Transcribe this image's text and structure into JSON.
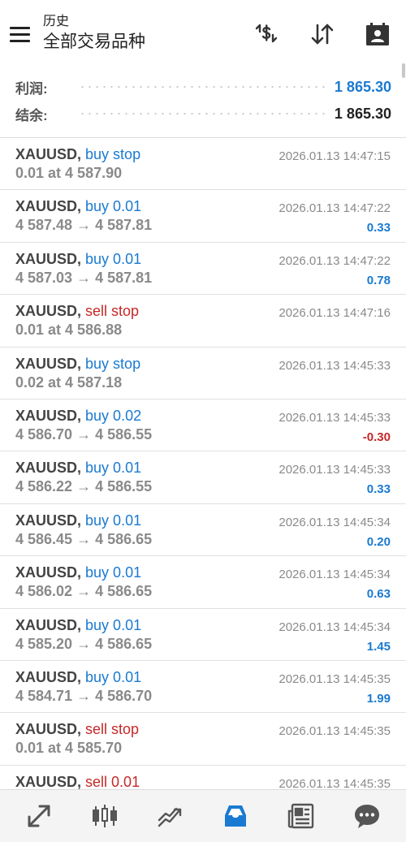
{
  "header": {
    "subtitle": "历史",
    "title": "全部交易品种",
    "icons": [
      "menu-icon",
      "currency-exchange-icon",
      "sort-icon",
      "calendar-icon"
    ]
  },
  "summary": {
    "profit_label": "利润:",
    "profit_value": "1 865.30",
    "balance_label": "结余:",
    "balance_value": "1 865.30"
  },
  "orders": [
    {
      "symbol": "XAUUSD,",
      "action": "buy stop",
      "side": "buy",
      "detail": "0.01 at 4 587.90",
      "time": "2026.01.13 14:47:15",
      "profit": ""
    },
    {
      "symbol": "XAUUSD,",
      "action": "buy 0.01",
      "side": "buy",
      "detail": "4 587.48 → 4 587.81",
      "time": "2026.01.13 14:47:22",
      "profit": "0.33"
    },
    {
      "symbol": "XAUUSD,",
      "action": "buy 0.01",
      "side": "buy",
      "detail": "4 587.03 → 4 587.81",
      "time": "2026.01.13 14:47:22",
      "profit": "0.78"
    },
    {
      "symbol": "XAUUSD,",
      "action": "sell stop",
      "side": "sell",
      "detail": "0.01 at 4 586.88",
      "time": "2026.01.13 14:47:16",
      "profit": ""
    },
    {
      "symbol": "XAUUSD,",
      "action": "buy stop",
      "side": "buy",
      "detail": "0.02 at 4 587.18",
      "time": "2026.01.13 14:45:33",
      "profit": ""
    },
    {
      "symbol": "XAUUSD,",
      "action": "buy 0.02",
      "side": "buy",
      "detail": "4 586.70 → 4 586.55",
      "time": "2026.01.13 14:45:33",
      "profit": "-0.30"
    },
    {
      "symbol": "XAUUSD,",
      "action": "buy 0.01",
      "side": "buy",
      "detail": "4 586.22 → 4 586.55",
      "time": "2026.01.13 14:45:33",
      "profit": "0.33"
    },
    {
      "symbol": "XAUUSD,",
      "action": "buy 0.01",
      "side": "buy",
      "detail": "4 586.45 → 4 586.65",
      "time": "2026.01.13 14:45:34",
      "profit": "0.20"
    },
    {
      "symbol": "XAUUSD,",
      "action": "buy 0.01",
      "side": "buy",
      "detail": "4 586.02 → 4 586.65",
      "time": "2026.01.13 14:45:34",
      "profit": "0.63"
    },
    {
      "symbol": "XAUUSD,",
      "action": "buy 0.01",
      "side": "buy",
      "detail": "4 585.20 → 4 586.65",
      "time": "2026.01.13 14:45:34",
      "profit": "1.45"
    },
    {
      "symbol": "XAUUSD,",
      "action": "buy 0.01",
      "side": "buy",
      "detail": "4 584.71 → 4 586.70",
      "time": "2026.01.13 14:45:35",
      "profit": "1.99"
    },
    {
      "symbol": "XAUUSD,",
      "action": "sell stop",
      "side": "sell",
      "detail": "0.01 at 4 585.70",
      "time": "2026.01.13 14:45:35",
      "profit": ""
    },
    {
      "symbol": "XAUUSD,",
      "action": "sell 0.01",
      "side": "sell",
      "detail": "",
      "time": "2026.01.13 14:45:35",
      "profit": ""
    }
  ],
  "tabbar": {
    "tabs": [
      "quotes-icon",
      "chart-icon",
      "trade-icon",
      "history-icon",
      "news-icon",
      "messages-icon"
    ],
    "active": "history-icon"
  },
  "colors": {
    "buy": "#1a7ad1",
    "sell": "#c62828",
    "active_tab": "#1a7ad1",
    "inactive_tab": "#555555"
  }
}
